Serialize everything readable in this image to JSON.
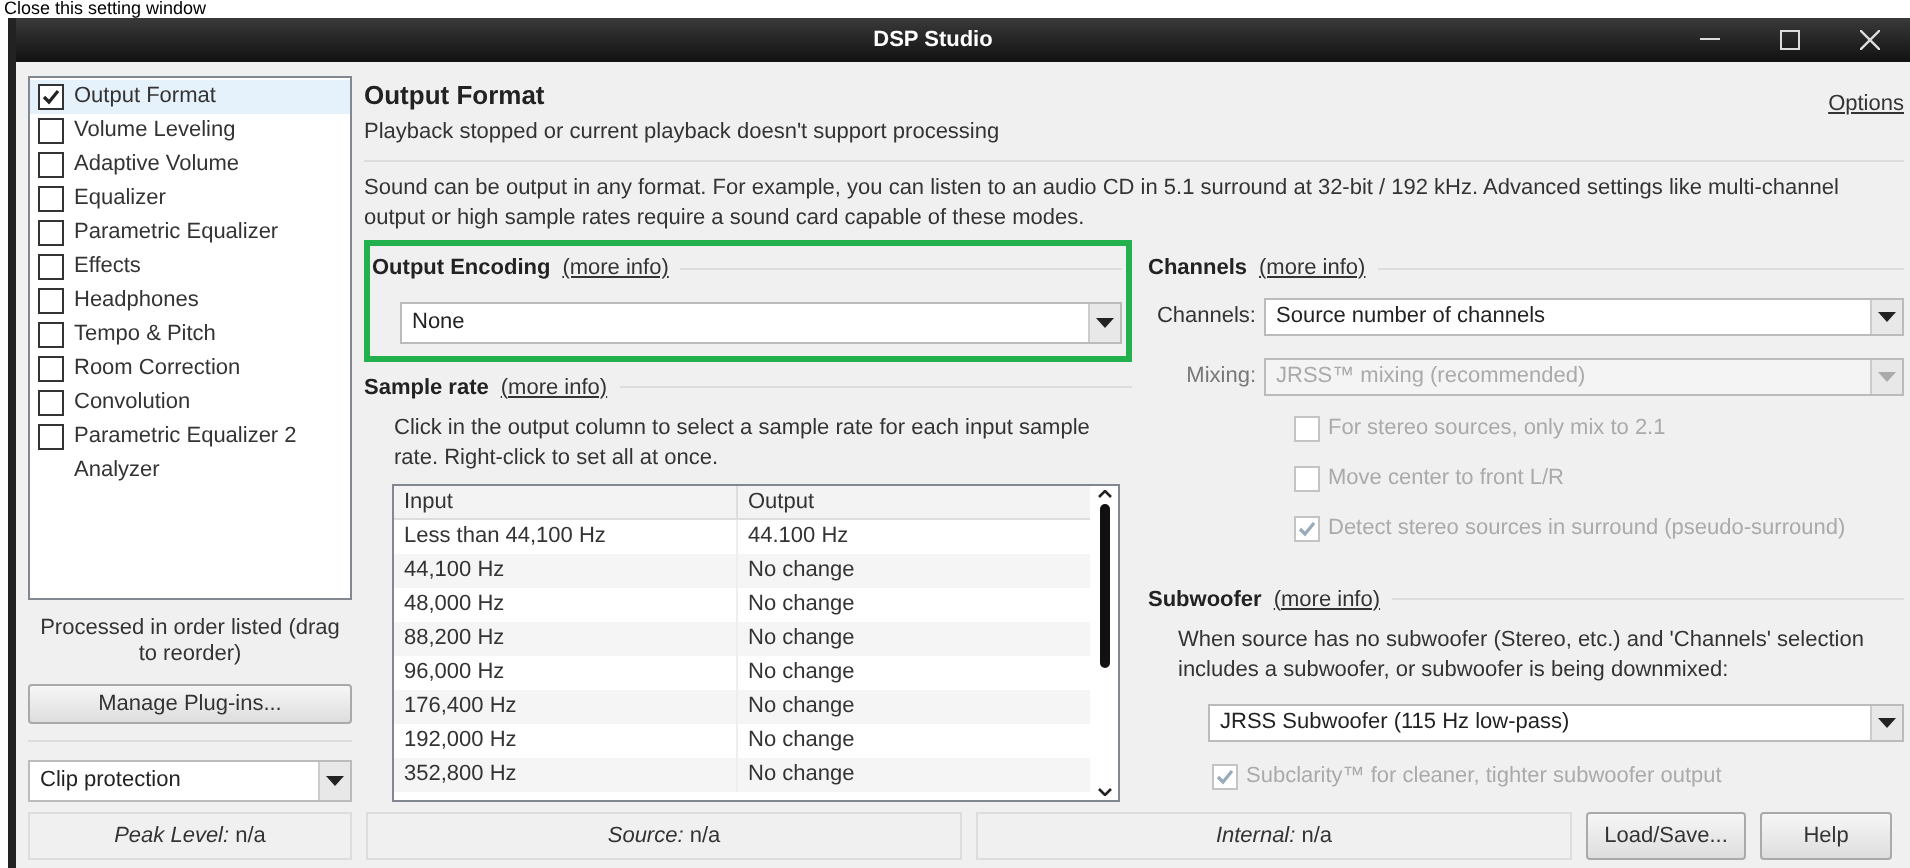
{
  "caption": "Close this setting window",
  "window": {
    "title": "DSP Studio"
  },
  "plugins": [
    {
      "label": "Output Format",
      "kind": "checkbox",
      "checked": true,
      "selected": true
    },
    {
      "label": "Volume Leveling",
      "kind": "checkbox",
      "checked": false,
      "selected": false
    },
    {
      "label": "Adaptive Volume",
      "kind": "checkbox",
      "checked": false,
      "selected": false
    },
    {
      "label": "Equalizer",
      "kind": "checkbox",
      "checked": false,
      "selected": false
    },
    {
      "label": "Parametric Equalizer",
      "kind": "checkbox",
      "checked": false,
      "selected": false
    },
    {
      "label": "Effects",
      "kind": "checkbox",
      "checked": false,
      "selected": false
    },
    {
      "label": "Headphones",
      "kind": "checkbox",
      "checked": false,
      "selected": false
    },
    {
      "label": "Tempo & Pitch",
      "kind": "checkbox",
      "checked": false,
      "selected": false
    },
    {
      "label": "Room Correction",
      "kind": "checkbox",
      "checked": false,
      "selected": false
    },
    {
      "label": "Convolution",
      "kind": "checkbox",
      "checked": false,
      "selected": false
    },
    {
      "label": "Parametric Equalizer 2",
      "kind": "checkbox",
      "checked": false,
      "selected": false
    },
    {
      "label": "Analyzer",
      "kind": "plain",
      "selected": false
    }
  ],
  "plugins_note": "Processed in order listed (drag to reorder)",
  "manage_button": "Manage Plug-ins...",
  "clip_select": {
    "value": "Clip protection"
  },
  "page": {
    "title": "Output Format",
    "subtitle": "Playback stopped or current playback doesn't support processing",
    "options_link": "Options",
    "description": "Sound can be output in any format.  For example, you can listen to an audio CD in 5.1 surround at 32-bit / 192 kHz.  Advanced settings like multi-channel output or high sample rates require a sound card capable of these modes."
  },
  "output_encoding": {
    "heading": "Output Encoding",
    "more_info": "(more info)",
    "value": "None",
    "highlighted": true
  },
  "sample_rate": {
    "heading": "Sample rate",
    "more_info": "(more info)",
    "description": "Click in the output column to select a sample rate for each input sample rate.  Right-click to set all at once.",
    "columns": [
      "Input",
      "Output"
    ],
    "rows": [
      [
        "Less than 44,100 Hz",
        "44.100 Hz"
      ],
      [
        "44,100 Hz",
        "No change"
      ],
      [
        "48,000 Hz",
        "No change"
      ],
      [
        "88,200 Hz",
        "No change"
      ],
      [
        "96,000 Hz",
        "No change"
      ],
      [
        "176,400 Hz",
        "No change"
      ],
      [
        "192,000 Hz",
        "No change"
      ],
      [
        "352,800 Hz",
        "No change"
      ]
    ]
  },
  "channels": {
    "heading": "Channels",
    "more_info": "(more info)",
    "channels_label": "Channels:",
    "channels_value": "Source number of channels",
    "mixing_label": "Mixing:",
    "mixing_value": "JRSS™ mixing (recommended)",
    "mixing_disabled": true,
    "options": [
      {
        "label": "For stereo sources, only mix to 2.1",
        "checked": false,
        "disabled": true
      },
      {
        "label": "Move center to front L/R",
        "checked": false,
        "disabled": true
      },
      {
        "label": "Detect stereo sources in surround (pseudo-surround)",
        "checked": true,
        "disabled": true
      }
    ]
  },
  "subwoofer": {
    "heading": "Subwoofer",
    "more_info": "(more info)",
    "description": "When source has no subwoofer (Stereo, etc.) and 'Channels' selection includes a subwoofer, or subwoofer is being downmixed:",
    "value": "JRSS Subwoofer (115 Hz low-pass)",
    "option": {
      "label": "Subclarity™ for cleaner, tighter subwoofer output",
      "checked": true,
      "disabled": true
    }
  },
  "status": [
    "*Peak Level:* n/a",
    "*Source:* n/a",
    "*Internal:* n/a"
  ],
  "buttons": [
    "Load/Save...",
    "Help"
  ]
}
